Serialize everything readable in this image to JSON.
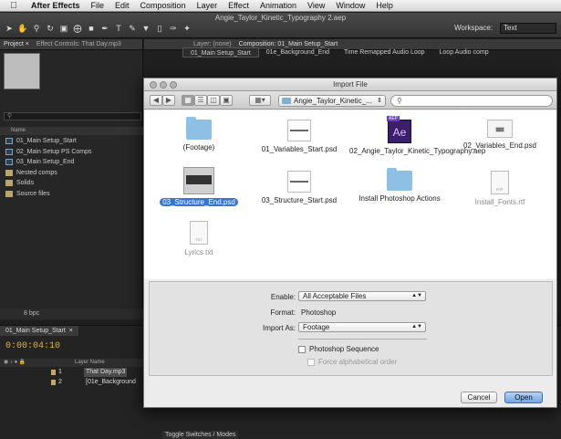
{
  "menubar": {
    "apple": "",
    "app": "After Effects",
    "items": [
      "File",
      "Edit",
      "Composition",
      "Layer",
      "Effect",
      "Animation",
      "View",
      "Window",
      "Help"
    ]
  },
  "window": {
    "title": "Angie_Taylor_Kinetic_Typography 2.aep",
    "workspace_label": "Workspace:",
    "workspace_value": "Text"
  },
  "project_panel": {
    "tabs": [
      "Project ×",
      "Effect Controls: That Day.mp3"
    ],
    "search_placeholder": "",
    "column_name": "Name",
    "items": [
      {
        "label": "01_Main Setup_Start",
        "type": "comp"
      },
      {
        "label": "02_Main Setup PS Comps",
        "type": "comp"
      },
      {
        "label": "03_Main Setup_End",
        "type": "comp"
      },
      {
        "label": "Nested comps",
        "type": "folder"
      },
      {
        "label": "Solids",
        "type": "folder"
      },
      {
        "label": "Source files",
        "type": "folder"
      }
    ],
    "bpc": "8 bpc"
  },
  "composition_panel": {
    "layer_tab": "Layer: (none)",
    "comp_tab": "Composition: 01_Main Setup_Start",
    "flow": [
      "01_Main Setup_Start",
      "01e_Background_End",
      "Time Remapped Audio Loop",
      "Loop Audio comp"
    ]
  },
  "timeline": {
    "tab": "01_Main Setup_Start",
    "timecode": "0:00:04:10",
    "col_layer_name": "Layer Name",
    "layers": [
      {
        "num": "1",
        "name": "That Day.mp3"
      },
      {
        "num": "2",
        "name": "[01e_Background"
      }
    ],
    "toggle": "Toggle Switches / Modes"
  },
  "dialog": {
    "title": "Import File",
    "path": "Angie_Taylor_Kinetic_...",
    "search_placeholder": "",
    "files": [
      {
        "label": "(Footage)",
        "icon": "folder"
      },
      {
        "label": "01_Variables_Start.psd",
        "icon": "doc"
      },
      {
        "label": "02_Angie_Taylor_Kinetic_Typography.aep",
        "icon": "ae",
        "tag": "AEP",
        "glyph": "Ae"
      },
      {
        "label": "02_Variables_End.psd",
        "icon": "thumb"
      },
      {
        "label": "03_Structure_End.psd",
        "icon": "selthumb"
      },
      {
        "label": "03_Structure_Start.psd",
        "icon": "doc"
      },
      {
        "label": "Install Photoshop Actions",
        "icon": "folder"
      },
      {
        "label": "Install_Fonts.rtf",
        "icon": "blank",
        "ext": "RTF"
      },
      {
        "label": "Lyrics.txt",
        "icon": "blank",
        "ext": "TXT"
      }
    ],
    "enable_label": "Enable:",
    "enable_value": "All Acceptable Files",
    "format_label": "Format:",
    "format_value": "Photoshop",
    "import_as_label": "Import As:",
    "import_as_value": "Footage",
    "photoshop_sequence": "Photoshop Sequence",
    "force_alpha": "Force alphabetical order",
    "cancel": "Cancel",
    "open": "Open"
  }
}
